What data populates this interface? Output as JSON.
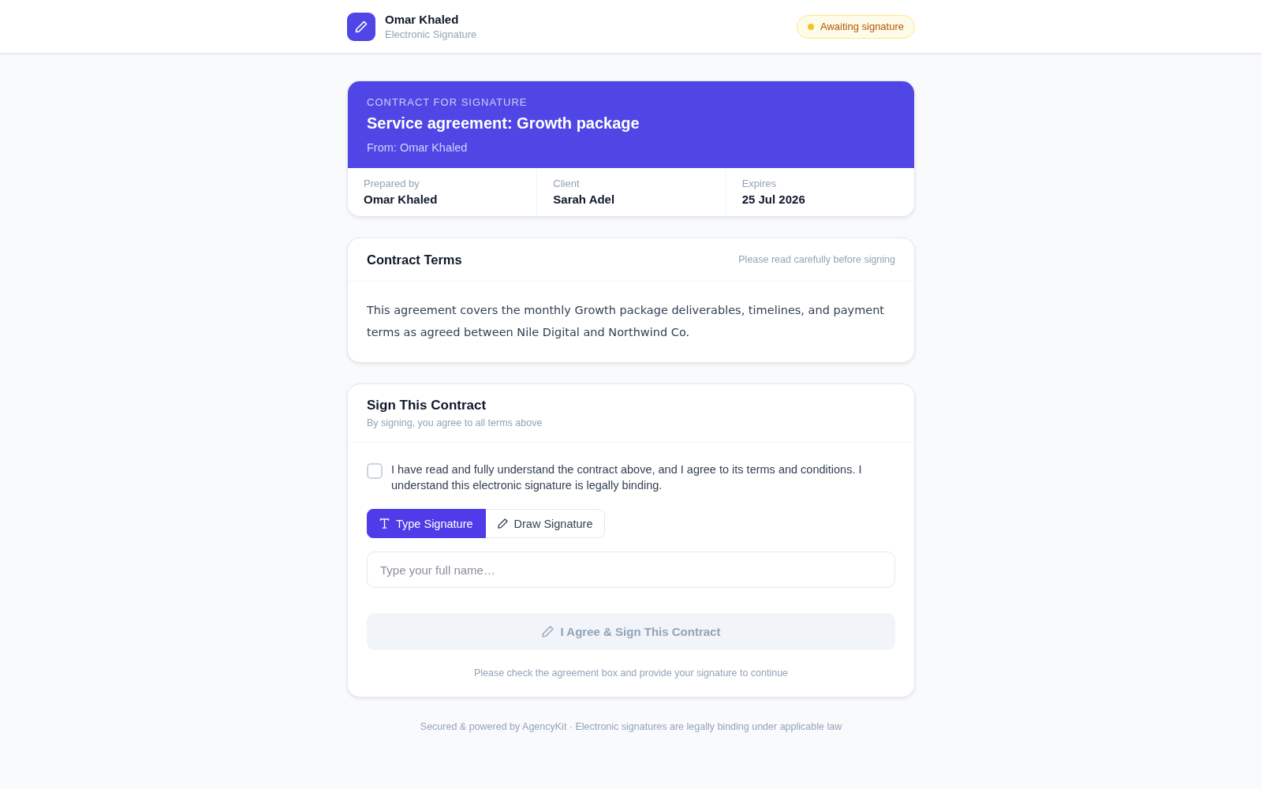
{
  "header": {
    "name": "Omar Khaled",
    "subtitle": "Electronic Signature",
    "status": "Awaiting signature"
  },
  "contract": {
    "eyebrow": "CONTRACT FOR SIGNATURE",
    "title": "Service agreement: Growth package",
    "from": "From: Omar Khaled",
    "meta": [
      {
        "label": "Prepared by",
        "value": "Omar Khaled"
      },
      {
        "label": "Client",
        "value": "Sarah Adel"
      },
      {
        "label": "Expires",
        "value": "25 Jul 2026"
      }
    ]
  },
  "terms": {
    "title": "Contract Terms",
    "hint": "Please read carefully before signing",
    "body": "This agreement covers the monthly Growth package deliverables, timelines, and payment terms as agreed between Nile Digital and Northwind Co."
  },
  "sign": {
    "title": "Sign This Contract",
    "subtitle": "By signing, you agree to all terms above",
    "agreement": {
      "label": "I have read and fully understand the contract above, and I agree to its terms and conditions. I understand this electronic signature is legally binding.",
      "checked": false
    },
    "modes": [
      {
        "label": "Type Signature",
        "kind": "type",
        "selected": true
      },
      {
        "label": "Draw Signature",
        "kind": "draw",
        "selected": false
      }
    ],
    "name_field": {
      "placeholder": "Type your full name…"
    },
    "submit": {
      "label": "I Agree & Sign This Contract",
      "disabled": true
    },
    "hint": "Please check the agreement box and provide your signature to continue"
  },
  "footer": "Secured & powered by AgencyKit · Electronic signatures are legally binding under applicable law"
}
